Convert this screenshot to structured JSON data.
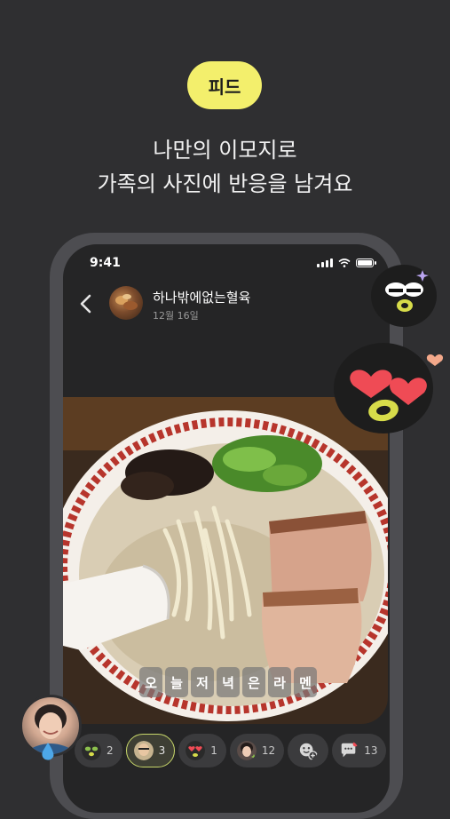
{
  "badge": {
    "label": "피드"
  },
  "headline": {
    "line1": "나만의 이모지로",
    "line2": "가족의 사진에 반응을 남겨요"
  },
  "phone": {
    "status": {
      "time": "9:41"
    },
    "post": {
      "author": "하나밖에없는혈육",
      "date": "12월 16일",
      "caption_chars": [
        "오",
        "늘",
        "저",
        "녁",
        "은",
        "라",
        "멘"
      ]
    },
    "reactions": [
      {
        "icon": "green-wink-emoji-icon",
        "count": "2",
        "selected": false
      },
      {
        "icon": "person-photo-emoji-icon",
        "count": "3",
        "selected": true
      },
      {
        "icon": "heart-eyes-emoji-icon",
        "count": "1",
        "selected": false
      },
      {
        "icon": "person-sparkle-emoji-icon",
        "count": "12",
        "selected": false
      },
      {
        "icon": "add-emoji-icon",
        "count": "",
        "selected": false
      },
      {
        "icon": "comment-icon",
        "count": "13",
        "selected": false
      }
    ]
  },
  "colors": {
    "background": "#2f2f31",
    "badge": "#f3ef6c",
    "accent_green": "#c7d66a"
  }
}
